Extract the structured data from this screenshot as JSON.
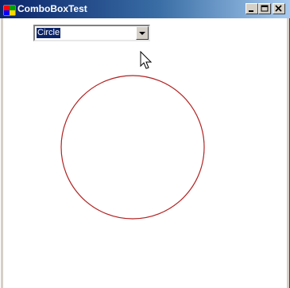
{
  "window": {
    "title": "ComboBoxTest",
    "controls": [
      "minimize-icon",
      "maximize-icon",
      "close-icon"
    ]
  },
  "combobox": {
    "selected": "Circle"
  },
  "canvas": {
    "shape": "circle",
    "stroke_color": "#b22222"
  },
  "colors": {
    "titlebar_start": "#0a246a",
    "titlebar_end": "#a6caf0",
    "selection": "#0a246a",
    "face": "#d4d0c8"
  }
}
